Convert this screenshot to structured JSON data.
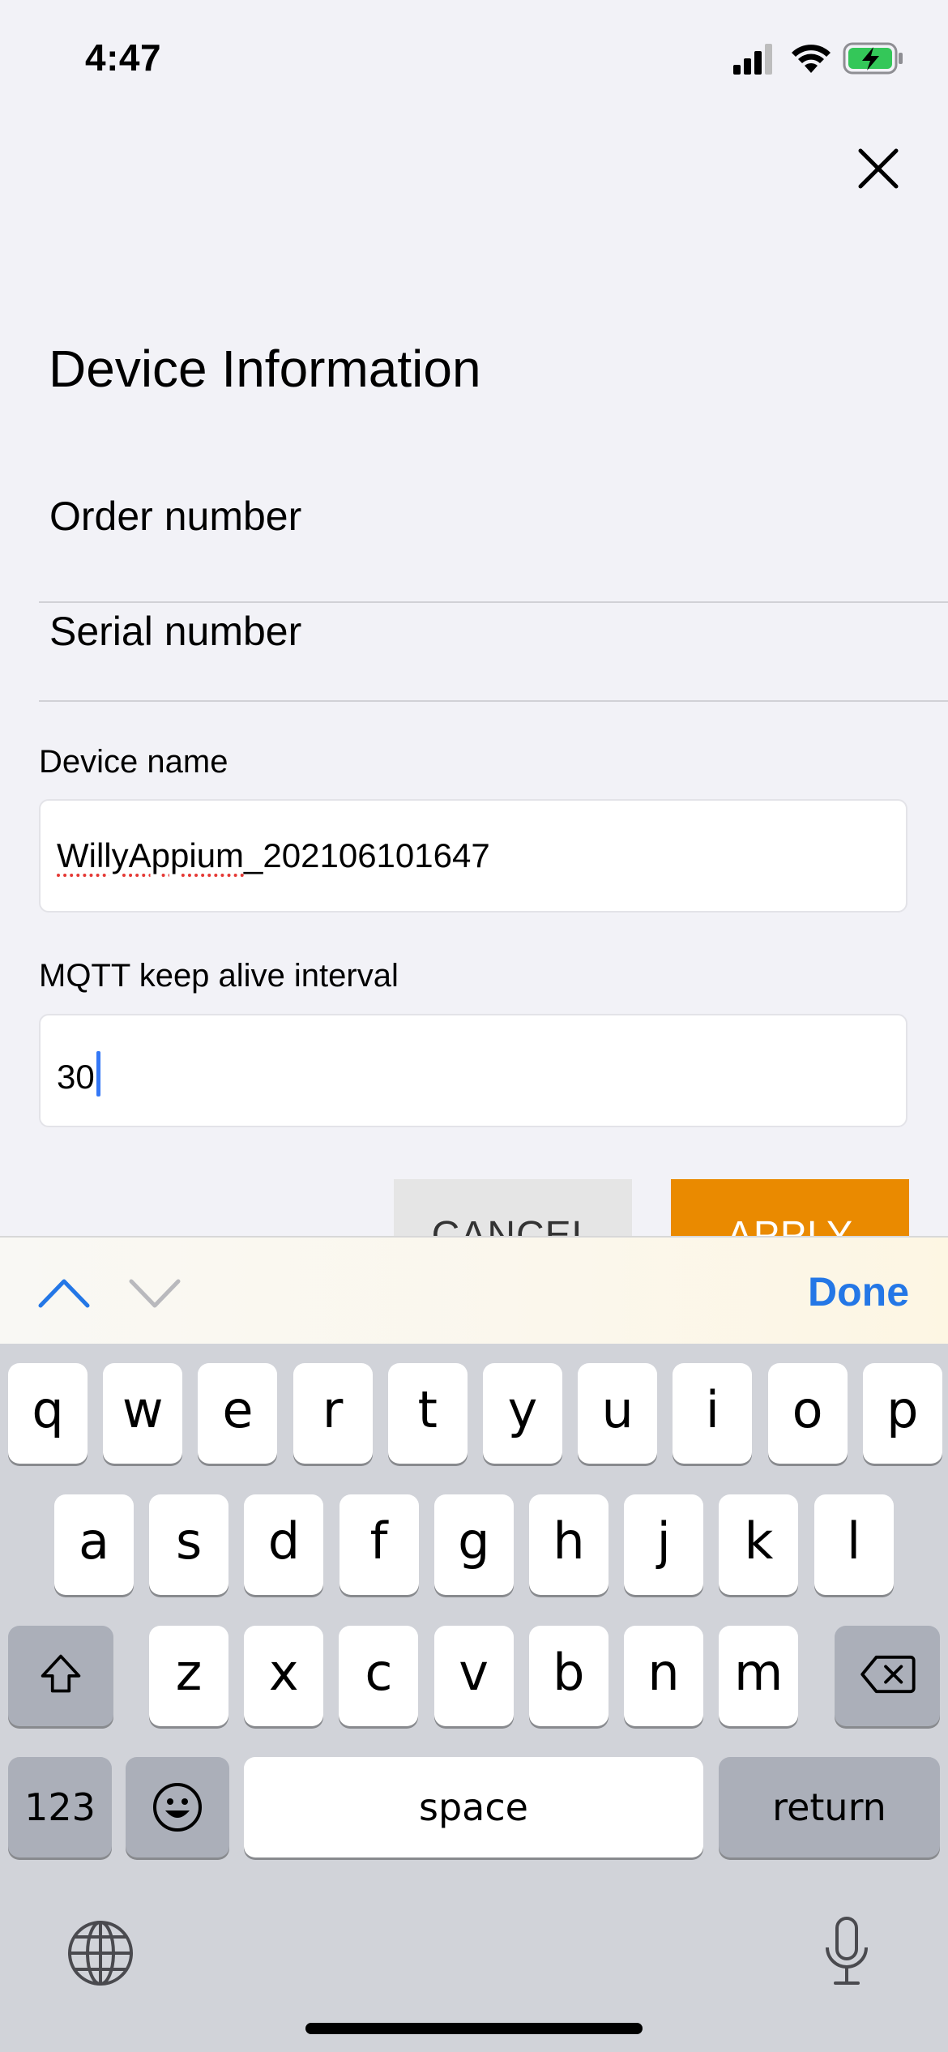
{
  "status_bar": {
    "time": "4:47"
  },
  "page": {
    "title": "Device Information",
    "order_number_label": "Order number",
    "serial_number_label": "Serial number",
    "device_name_label": "Device name",
    "device_name_value_misspelled": "WillyAppium",
    "device_name_value_rest": "_202106101647",
    "mqtt_label": "MQTT keep alive interval",
    "mqtt_value": "30",
    "cancel_label": "CANCEL",
    "apply_label": "APPLY"
  },
  "accessory": {
    "done_label": "Done"
  },
  "keyboard": {
    "row1": [
      "q",
      "w",
      "e",
      "r",
      "t",
      "y",
      "u",
      "i",
      "o",
      "p"
    ],
    "row2": [
      "a",
      "s",
      "d",
      "f",
      "g",
      "h",
      "j",
      "k",
      "l"
    ],
    "row3": [
      "z",
      "x",
      "c",
      "v",
      "b",
      "n",
      "m"
    ],
    "numbers_label": "123",
    "space_label": "space",
    "return_label": "return"
  },
  "colors": {
    "accent": "#ea8a00",
    "link": "#2477e6",
    "background": "#f2f2f7"
  }
}
